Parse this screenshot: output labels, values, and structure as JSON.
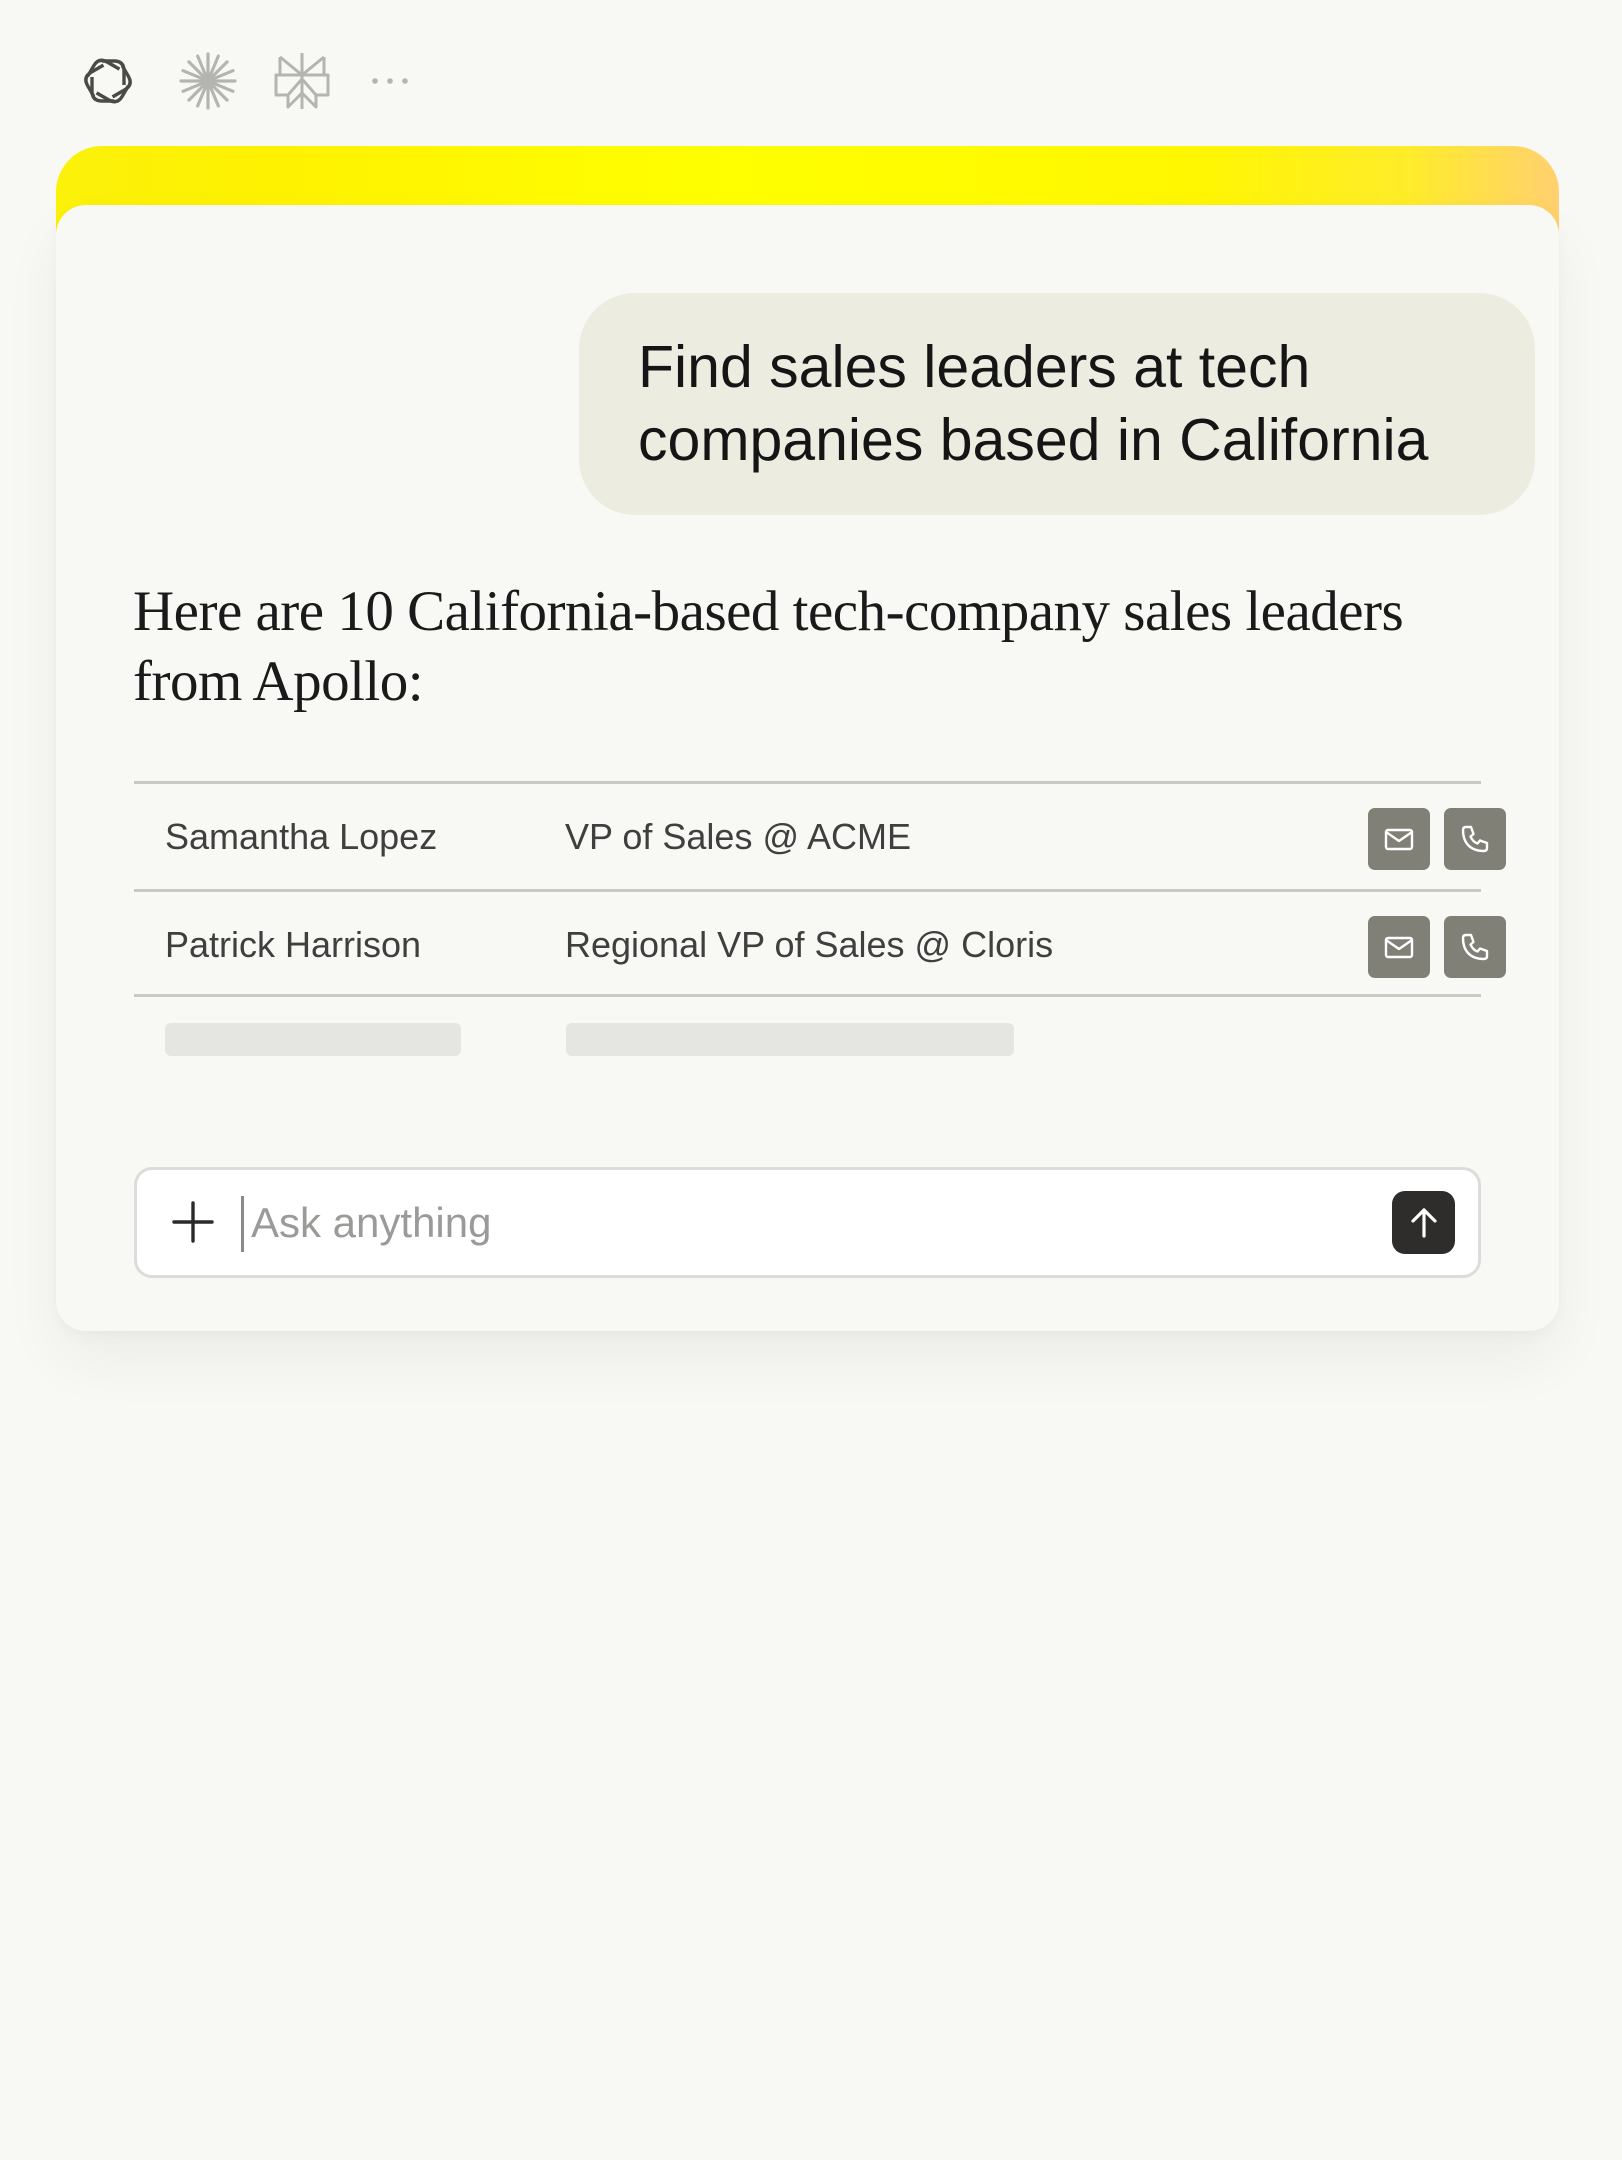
{
  "providers": [
    {
      "icon": "openai-icon"
    },
    {
      "icon": "sparkle-asterisk-icon"
    },
    {
      "icon": "perplexity-icon"
    },
    {
      "icon": "more-dots-icon"
    }
  ],
  "colors": {
    "page_background": "#f8f8f4",
    "glow_yellow": "#ffff00",
    "user_bubble": "#ecece1",
    "action_button": "#808076",
    "send_button": "#2f2d2b"
  },
  "chat": {
    "user_message": "Find sales leaders at tech companies based in California",
    "assistant_message": "Here are 10 California-based tech-company sales leaders from Apollo:"
  },
  "results": [
    {
      "name": "Samantha Lopez",
      "title": "VP of Sales @ ACME"
    },
    {
      "name": "Patrick Harrison",
      "title": "Regional VP of Sales @ Cloris"
    }
  ],
  "composer": {
    "placeholder": "Ask anything"
  }
}
